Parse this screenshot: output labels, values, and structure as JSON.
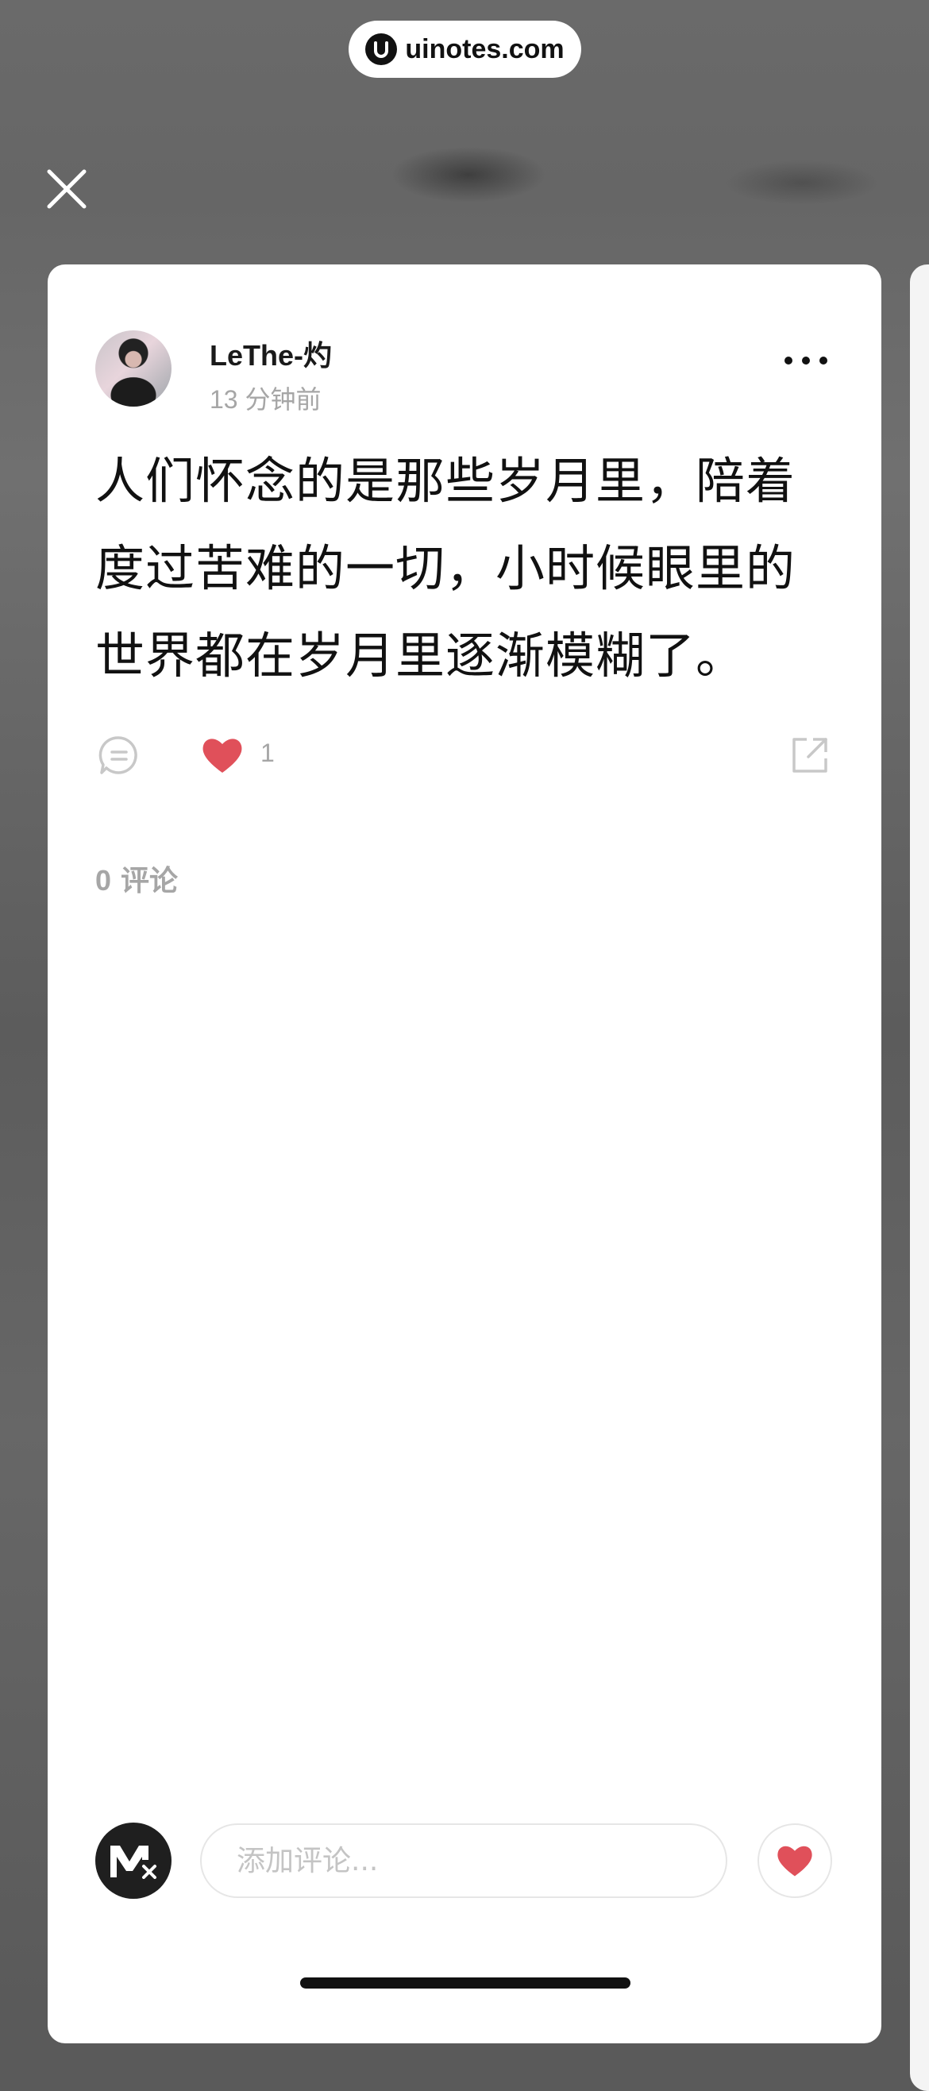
{
  "watermark": {
    "text": "uinotes.com"
  },
  "post": {
    "author": "LeThe-灼",
    "time_ago": "13 分钟前",
    "body_lines": [
      "人们怀念的是那些岁月里，陪着",
      "度过苦难的一切，小时候眼里的",
      "世界都在岁月里逐渐模糊了。"
    ],
    "like_count": "1",
    "liked": true,
    "comment_count": "0",
    "comment_label": "评论"
  },
  "composer": {
    "placeholder": "添加评论...",
    "value": ""
  },
  "colors": {
    "like": "#e0505a",
    "muted": "#a6a6a6",
    "text": "#111111"
  },
  "icons": {
    "close": "close-icon",
    "more": "more-horizontal-icon",
    "comment": "comment-bubble-icon",
    "like": "heart-icon",
    "share": "external-share-icon",
    "watermark_logo": "uinotes-logo-icon",
    "user_avatar": "avatar-m-logo-icon"
  }
}
